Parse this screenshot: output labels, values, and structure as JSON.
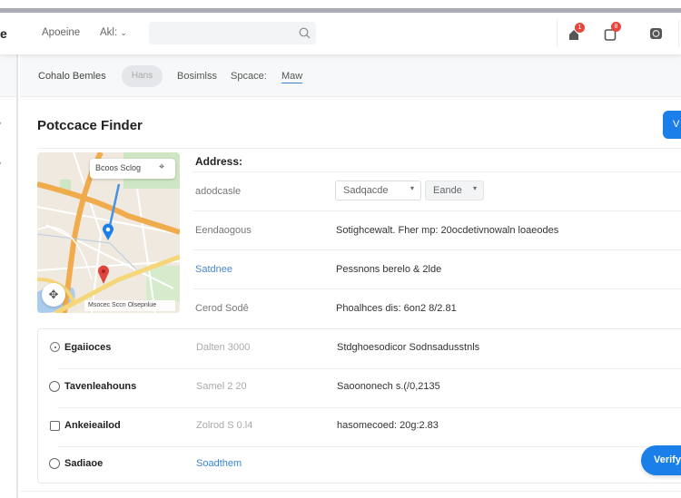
{
  "header": {
    "brand_fragment": "e",
    "nav": [
      "Apoeine",
      "Akl:"
    ],
    "search": {
      "placeholder": ""
    },
    "notifications": [
      {
        "icon": "home-alert-icon",
        "count": "1"
      },
      {
        "icon": "inbox-icon",
        "count": "8"
      }
    ]
  },
  "subnav": {
    "items": [
      "Cohalo Bemles",
      "Hans",
      "Bosimlss",
      "Spcace:",
      "Maw"
    ],
    "active_index": 4
  },
  "page": {
    "title": "Potccace Finder",
    "primary_button": "V"
  },
  "map": {
    "search_label": "Bcoos Sclog",
    "attribution": "Msocec Sccn Olsepnlue"
  },
  "address": {
    "heading": "Address:",
    "rows": [
      {
        "label": "adodcasle",
        "select1": "Sadqacde",
        "select2": "Eande"
      },
      {
        "label": "Eendaogous",
        "value": "Sotighcewalt. Fher mp: 20ocdetivnowaln loaeodes"
      },
      {
        "label": "Satdnee",
        "value": "Pessnons berelo & 2lde",
        "label_link": true
      },
      {
        "label": "Cerod Sodê",
        "value": "Phoalhces dis: 6on2 8/2.81"
      }
    ]
  },
  "list": {
    "rows": [
      {
        "control": "radio-checked",
        "name": "Egaiioces",
        "meta": "Dalten 3000",
        "detail": "Stdghoesodicor Sodnsadusstnls"
      },
      {
        "control": "radio",
        "name": "Tavenleahouns",
        "meta": "Samel 2 20",
        "detail": "Saoononech s.(/0,2135"
      },
      {
        "control": "checkbox",
        "name": "Ankeieailod",
        "meta": "Zolrod S 0.l4",
        "detail": "hasomecoed: 20g:2.83"
      },
      {
        "control": "radio",
        "name": "Sadiaoe",
        "meta": "Soadthem",
        "meta_link": true,
        "detail": ""
      }
    ]
  },
  "verify_button": "Verify",
  "colors": {
    "accent": "#1a7fe8",
    "badge": "#e8453c"
  }
}
